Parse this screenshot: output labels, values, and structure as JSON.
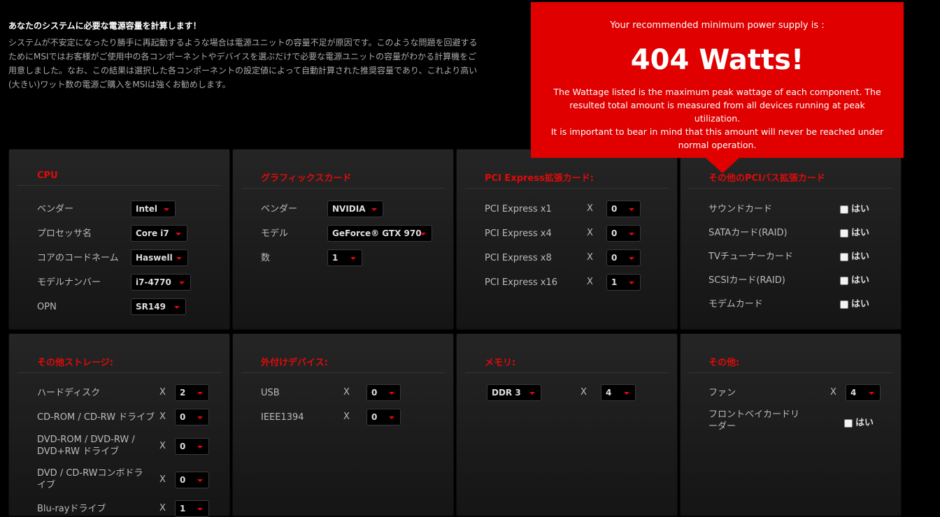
{
  "intro": {
    "title": "あなたのシステムに必要な電源容量を計算します！",
    "lines": [
      "システムが不安定になったり勝手に再起動するような場合は電源ユニットの容量不足が原因です。このような問題を回避する",
      "ためにMSIではお客様がご使用中の各コンポーネントやデバイスを選ぶだけで必要な電源ユニットの容量がわかる計算機をご",
      "用意しました。なお、この結果は選択した各コンポーネントの設定値によって自動計算された推奨容量であり、これより高い",
      "(大きい)ワット数の電源ご購入をMSIは強くお勧めします。"
    ]
  },
  "result": {
    "label": "Your recommended minimum power supply is :",
    "watts": "404 Watts!",
    "note": [
      "The Wattage listed is the maximum peak wattage of each component. The",
      "resulted total amount is measured from all devices running at peak utilization.",
      "It is important to bear in mind that this amount will never be reached under",
      "normal operation."
    ]
  },
  "cpu": {
    "title": "CPU",
    "vendor_label": "ベンダー",
    "vendor": "Intel",
    "processor_label": "プロセッサ名",
    "processor": "Core i7",
    "codename_label": "コアのコードネーム",
    "codename": "Haswell",
    "model_label": "モデルナンバー",
    "model": "i7-4770",
    "opn_label": "OPN",
    "opn": "SR149"
  },
  "gpu": {
    "title": "グラフィックスカード",
    "vendor_label": "ベンダー",
    "vendor": "NVIDIA",
    "model_label": "モデル",
    "model": "GeForce® GTX 970",
    "count_label": "数",
    "count": "1"
  },
  "pcie": {
    "title": "PCI Express拡張カード:",
    "x_symbol": "X",
    "items": [
      {
        "label": "PCI Express x1",
        "value": "0"
      },
      {
        "label": "PCI Express x4",
        "value": "0"
      },
      {
        "label": "PCI Express x8",
        "value": "0"
      },
      {
        "label": "PCI Express x16",
        "value": "1"
      }
    ]
  },
  "pci_other": {
    "title": "その他のPCIバス拡張カード",
    "yes_label": "はい",
    "items": [
      "サウンドカード",
      "SATAカード(RAID)",
      "TVチューナーカード",
      "SCSIカード(RAID)",
      "モデムカード"
    ]
  },
  "storage": {
    "title": "その他ストレージ:",
    "items": [
      {
        "label": "ハードディスク",
        "value": "2"
      },
      {
        "label": "CD-ROM / CD-RW ドライブ",
        "value": "0"
      },
      {
        "label": "DVD-ROM / DVD-RW / DVD+RW ドライブ",
        "value": "0"
      },
      {
        "label": "DVD / CD-RWコンボドライブ",
        "value": "0"
      },
      {
        "label": "Blu-rayドライブ",
        "value": "1"
      }
    ]
  },
  "external": {
    "title": "外付けデバイス:",
    "items": [
      {
        "label": "USB",
        "value": "0"
      },
      {
        "label": "IEEE1394",
        "value": "0"
      }
    ]
  },
  "memory": {
    "title": "メモリ:",
    "type": "DDR 3",
    "count": "4"
  },
  "other": {
    "title": "その他:",
    "fan_label": "ファン",
    "fan": "4",
    "reader_label": "フロントベイカードリーダー",
    "yes_label": "はい"
  },
  "colors": {
    "accent": "#e10a0a",
    "background": "#000000",
    "panel": "#1e1e1e"
  }
}
